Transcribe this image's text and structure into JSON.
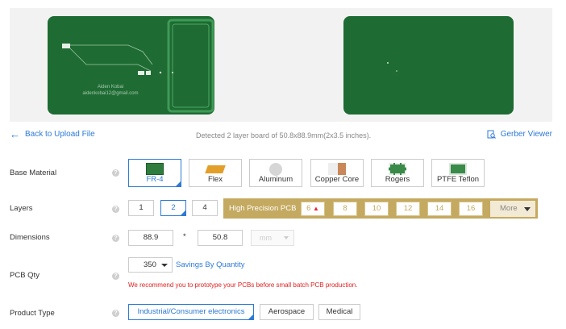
{
  "preview": {
    "silk_text_line1": "Aiden Kobai",
    "silk_text_line2": "aidenkobai12@gmail.com"
  },
  "info": {
    "back_label": "Back to Upload File",
    "detected_text": "Detected 2 layer board of 50.8x88.9mm(2x3.5 inches).",
    "gerber_label": "Gerber Viewer"
  },
  "base_material": {
    "label": "Base Material",
    "options": [
      "FR-4",
      "Flex",
      "Aluminum",
      "Copper Core",
      "Rogers",
      "PTFE Teflon"
    ],
    "selected": "FR-4"
  },
  "layers": {
    "label": "Layers",
    "options": [
      "1",
      "2",
      "4"
    ],
    "selected": "2",
    "high_precision": {
      "label": "High Precision PCB",
      "options": [
        "6",
        "8",
        "10",
        "12",
        "14",
        "16"
      ],
      "more_label": "More"
    }
  },
  "dimensions": {
    "label": "Dimensions",
    "width": "88.9",
    "separator": "*",
    "height": "50.8",
    "unit": "mm"
  },
  "pcb_qty": {
    "label": "PCB Qty",
    "value": "350",
    "savings_link": "Savings By Quantity",
    "warning": "We recommend you to prototype your PCBs before small batch PCB production."
  },
  "product_type": {
    "label": "Product Type",
    "options": [
      "Industrial/Consumer electronics",
      "Aerospace",
      "Medical"
    ],
    "selected": "Industrial/Consumer electronics"
  },
  "colors": {
    "accent": "#2d7ad6",
    "board_green": "#1e6b33",
    "gold": "#c4a960",
    "warning_red": "#e02020"
  }
}
